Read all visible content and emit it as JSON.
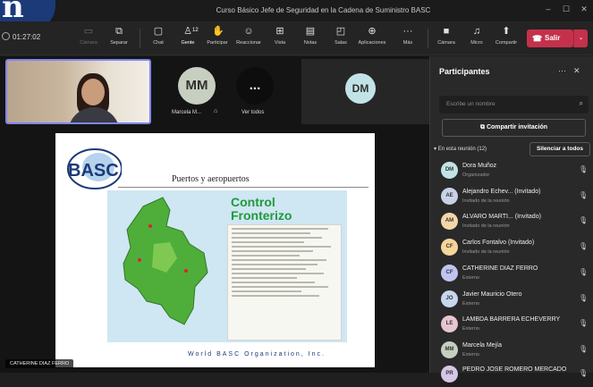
{
  "window": {
    "title": "Curso Básico Jefe de Seguridad en la Cadena de Suministro BASC"
  },
  "toolbar": {
    "timer": "01:27:02",
    "buttons": [
      {
        "label": "Cámara",
        "icon": "camera-icon",
        "dim": true
      },
      {
        "label": "Separar",
        "icon": "popout-icon"
      },
      {
        "label": "Chat",
        "icon": "chat-icon"
      },
      {
        "label": "Gente",
        "icon": "people-icon",
        "count": "12",
        "active": true
      },
      {
        "label": "Participar",
        "icon": "raise-hand-icon"
      },
      {
        "label": "Reaccionar",
        "icon": "emoji-icon"
      },
      {
        "label": "Vista",
        "icon": "view-icon"
      },
      {
        "label": "Notas",
        "icon": "notes-icon"
      },
      {
        "label": "Salas",
        "icon": "rooms-icon"
      },
      {
        "label": "Aplicaciones",
        "icon": "apps-icon"
      },
      {
        "label": "Más",
        "icon": "more-icon"
      },
      {
        "label": "Cámara",
        "icon": "camera-off-icon"
      },
      {
        "label": "Micro",
        "icon": "mic-off-icon"
      },
      {
        "label": "Compartir",
        "icon": "share-icon"
      }
    ],
    "leave_label": "Salir",
    "leave_color": "#c4314b"
  },
  "stage": {
    "participants": [
      {
        "initials": "MM",
        "label": "Marcela M...",
        "color": "#c6cfc0"
      },
      {
        "initials": "...",
        "label": "Ver todos",
        "color": "#0d0d0d"
      },
      {
        "initials": "DM",
        "label": "",
        "color": "#c2e3e6"
      }
    ],
    "slide": {
      "logo_text": "BASC",
      "heading": "Puertos y aeropuertos",
      "title_line1": "Control",
      "title_line2": "Fronterizo",
      "footer": "World BASC Organization, Inc."
    },
    "presenter_name": "CATHERINE DIAZ FERRO"
  },
  "panel": {
    "title": "Participantes",
    "search_placeholder": "Escribe un nombre",
    "share_invite": "Compartir invitación",
    "in_meeting": "En esta reunión (12)",
    "mute_all": "Silenciar a todos",
    "people": [
      {
        "initials": "DM",
        "name": "Dora Muñoz",
        "role": "Organizador",
        "color": "#c2e3e6"
      },
      {
        "initials": "AE",
        "name": "Alejandro Echev... (Invitado)",
        "role": "Invitado de la reunión",
        "color": "#c9d1e8"
      },
      {
        "initials": "AM",
        "name": "ALVARO MARTI... (Invitado)",
        "role": "Invitado de la reunión",
        "color": "#f3d7a8"
      },
      {
        "initials": "CF",
        "name": "Carlos Fontalvo (Invitado)",
        "role": "Invitado de la reunión",
        "color": "#f6d59b"
      },
      {
        "initials": "CF",
        "name": "CATHERINE DIAZ FERRO",
        "role": "Externo",
        "color": "#bfc4f2"
      },
      {
        "initials": "JO",
        "name": "Javier Mauricio Otero",
        "role": "Externo",
        "color": "#c7d7ef"
      },
      {
        "initials": "LE",
        "name": "LAMBDA BARRERA ECHEVERRY",
        "role": "Externo",
        "color": "#e8c6cf"
      },
      {
        "initials": "MM",
        "name": "Marcela Mejía",
        "role": "Externo",
        "color": "#c6cfc0"
      },
      {
        "initials": "PR",
        "name": "PEDRO JOSE ROMERO MERCADO",
        "role": "",
        "color": "#d6c6e8"
      }
    ]
  }
}
